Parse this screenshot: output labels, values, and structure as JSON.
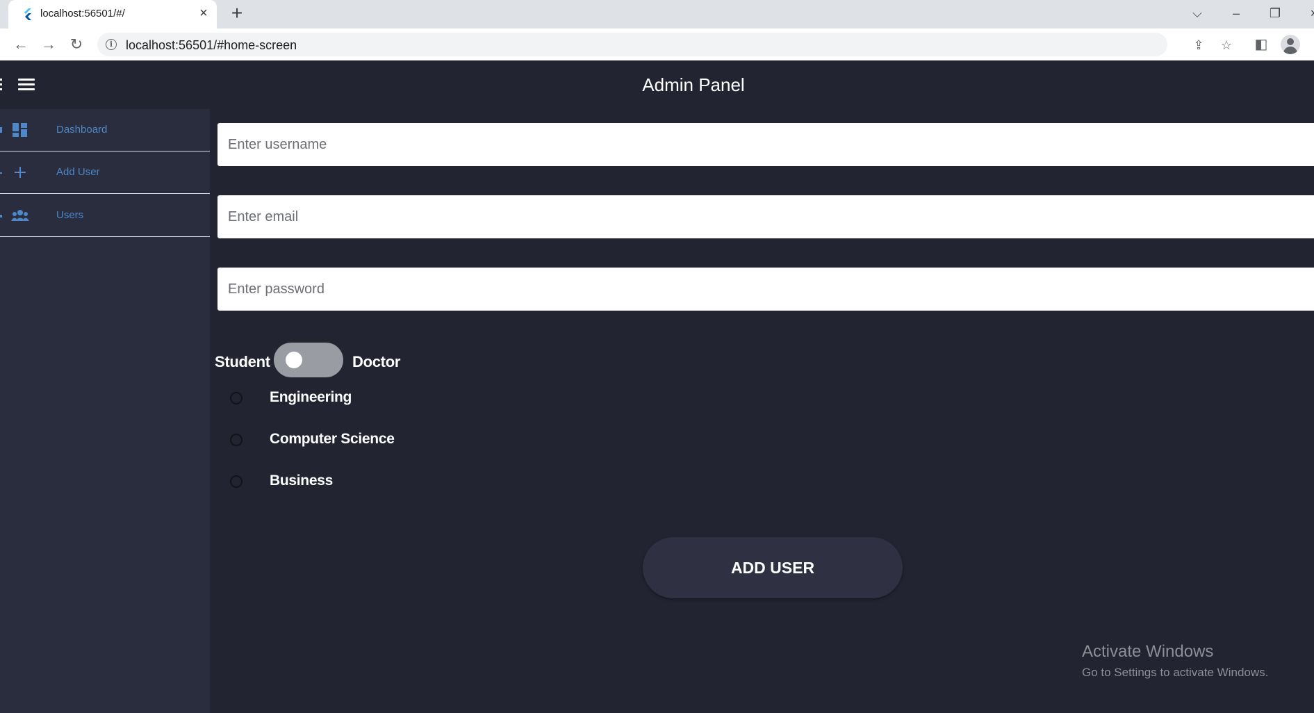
{
  "browser": {
    "tab_title": "localhost:56501/#/",
    "url": "localhost:56501/#home-screen",
    "icons": {
      "favicon": "flutter-icon",
      "close": "close-icon",
      "new_tab": "plus-icon",
      "back": "back-arrow-icon",
      "forward": "forward-arrow-icon",
      "reload": "reload-icon",
      "site_info": "info-icon",
      "share": "share-icon",
      "bookmark": "star-icon",
      "side_panel": "side-panel-icon",
      "profile": "avatar-icon"
    }
  },
  "app": {
    "title": "Admin Panel",
    "colors": {
      "background": "#222432",
      "sidebar": "#2a2d3e",
      "accent": "#4e88c8",
      "button": "#2f3143"
    }
  },
  "sidebar": {
    "items": [
      {
        "label": "Dashboard",
        "icon": "dashboard-icon"
      },
      {
        "label": "Add User",
        "icon": "plus-icon"
      },
      {
        "label": "Users",
        "icon": "people-icon"
      }
    ]
  },
  "form": {
    "username_placeholder": "Enter username",
    "email_placeholder": "Enter email",
    "password_placeholder": "Enter password",
    "role_left": "Student",
    "role_right": "Doctor",
    "role_toggle_on": false,
    "departments": [
      "Engineering",
      "Computer Science",
      "Business"
    ],
    "submit_label": "ADD USER"
  },
  "watermark": {
    "title": "Activate Windows",
    "subtitle": "Go to Settings to activate Windows."
  }
}
